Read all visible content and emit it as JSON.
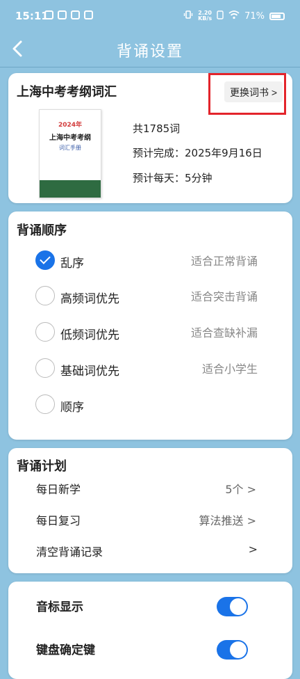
{
  "status_bar": {
    "time": "15:11",
    "net_speed_value": "2.20",
    "net_speed_unit": "KB/s",
    "battery": "71%"
  },
  "nav": {
    "title": "背诵设置"
  },
  "book": {
    "section_title": "上海中考考纲词汇",
    "change_button": "更换词书 >",
    "cover_year": "2024年",
    "cover_title": "上海中考考纲",
    "cover_subtitle": "词汇手册",
    "total": "共1785词",
    "finish_date": "预计完成：2025年9月16日",
    "daily_time": "预计每天：5分钟"
  },
  "order": {
    "title": "背诵顺序",
    "options": [
      {
        "label": "乱序",
        "hint": "适合正常背诵",
        "checked": true
      },
      {
        "label": "高频词优先",
        "hint": "适合突击背诵",
        "checked": false
      },
      {
        "label": "低频词优先",
        "hint": "适合查缺补漏",
        "checked": false
      },
      {
        "label": "基础词优先",
        "hint": "适合小学生",
        "checked": false
      },
      {
        "label": "顺序",
        "hint": "",
        "checked": false
      }
    ]
  },
  "plan": {
    "title": "背诵计划",
    "rows": [
      {
        "label": "每日新学",
        "value": "5个 >"
      },
      {
        "label": "每日复习",
        "value": "算法推送 >"
      },
      {
        "label": "清空背诵记录",
        "value": ">"
      }
    ]
  },
  "display": {
    "rows": [
      {
        "label": "音标显示",
        "enabled": true
      },
      {
        "label": "键盘确定键",
        "enabled": true
      }
    ]
  },
  "colors": {
    "background": "#8ec3e0",
    "accent": "#1a73e8",
    "highlight": "#e3242b"
  }
}
